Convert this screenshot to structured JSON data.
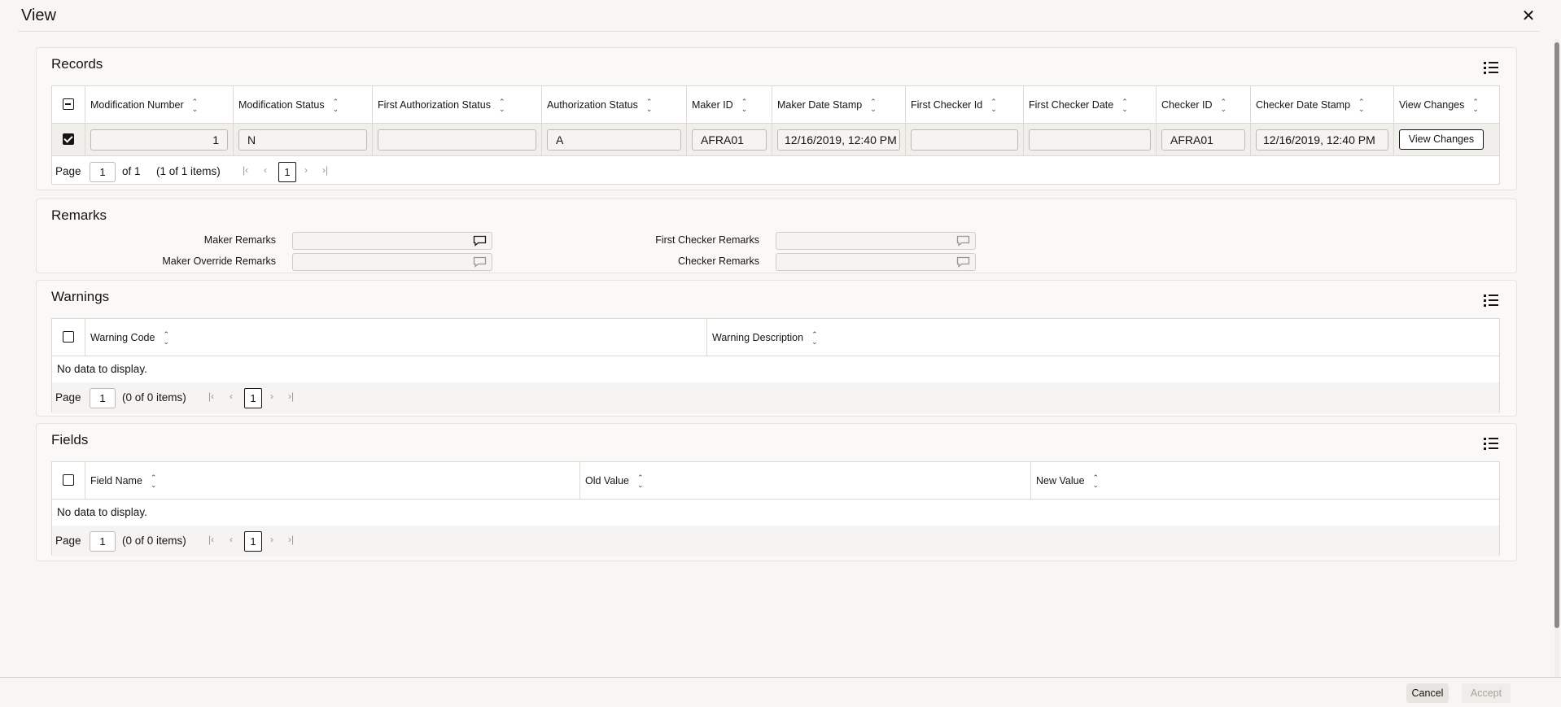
{
  "dialog": {
    "title": "View"
  },
  "records": {
    "title": "Records",
    "columns": [
      "Modification Number",
      "Modification Status",
      "First Authorization Status",
      "Authorization Status",
      "Maker ID",
      "Maker Date Stamp",
      "First Checker Id",
      "First Checker Date",
      "Checker ID",
      "Checker Date Stamp",
      "View Changes"
    ],
    "row": {
      "modification_number": "1",
      "modification_status": "N",
      "first_authorization_status": "",
      "authorization_status": "A",
      "maker_id": "AFRA01",
      "maker_date_stamp": "12/16/2019, 12:40 PM",
      "first_checker_id": "",
      "first_checker_date": "",
      "checker_id": "AFRA01",
      "checker_date_stamp": "12/16/2019, 12:40 PM",
      "view_changes_label": "View Changes"
    },
    "pager": {
      "page_label": "Page",
      "page_value": "1",
      "of_text": "of 1",
      "items_text": "(1 of 1 items)",
      "current_page": "1"
    }
  },
  "remarks": {
    "title": "Remarks",
    "maker_remarks_label": "Maker Remarks",
    "maker_override_remarks_label": "Maker Override Remarks",
    "first_checker_remarks_label": "First Checker Remarks",
    "checker_remarks_label": "Checker Remarks"
  },
  "warnings": {
    "title": "Warnings",
    "columns": [
      "Warning Code",
      "Warning Description"
    ],
    "no_data": "No data to display.",
    "pager": {
      "page_label": "Page",
      "page_value": "1",
      "items_text": "(0 of 0 items)",
      "current_page": "1"
    }
  },
  "fields": {
    "title": "Fields",
    "columns": [
      "Field Name",
      "Old Value",
      "New Value"
    ],
    "no_data": "No data to display.",
    "pager": {
      "page_label": "Page",
      "page_value": "1",
      "items_text": "(0 of 0 items)",
      "current_page": "1"
    }
  },
  "footer": {
    "cancel_label": "Cancel",
    "accept_label": "Accept"
  },
  "icons": {
    "close": "close-icon",
    "columns": "column-chooser-icon",
    "comment": "comment-icon",
    "sort": "sort-icon"
  }
}
